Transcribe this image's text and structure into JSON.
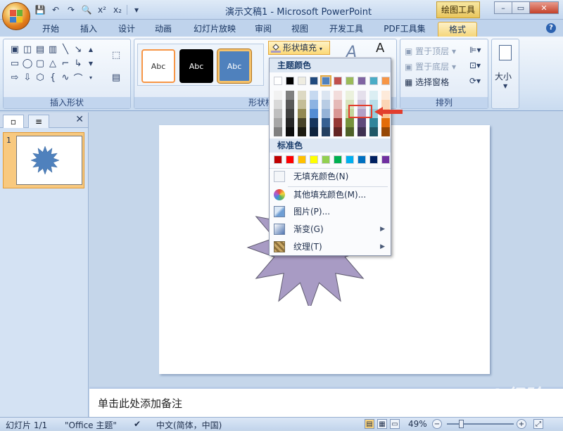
{
  "window": {
    "title": "演示文稿1 - Microsoft PowerPoint",
    "context_tab_title": "绘图工具"
  },
  "qat": {
    "save": "💾",
    "undo": "↶",
    "redo": "↷",
    "preview": "🔍",
    "superscript": "x²",
    "subscript": "x₂",
    "more": "▾"
  },
  "tabs": [
    {
      "label": "开始"
    },
    {
      "label": "插入"
    },
    {
      "label": "设计"
    },
    {
      "label": "动画"
    },
    {
      "label": "幻灯片放映"
    },
    {
      "label": "审阅"
    },
    {
      "label": "视图"
    },
    {
      "label": "开发工具"
    },
    {
      "label": "PDF工具集"
    },
    {
      "label": "格式"
    }
  ],
  "ribbon": {
    "insert_shapes_label": "插入形状",
    "shape_styles_label": "形状样式",
    "arrange_label": "排列",
    "size_label": "大小",
    "style_samples": [
      "Abc",
      "Abc",
      "Abc"
    ],
    "shape_fill_label": "形状填充",
    "arrange_items": {
      "bring_to_front": "置于顶层",
      "send_to_back": "置于底层",
      "selection_pane": "选择窗格"
    }
  },
  "dropdown": {
    "theme_colors_header": "主题颜色",
    "standard_colors_header": "标准色",
    "theme_top": [
      "#ffffff",
      "#000000",
      "#eeece1",
      "#1f497d",
      "#4f81bd",
      "#c0504d",
      "#9bbb59",
      "#8064a2",
      "#4bacc6",
      "#f79646"
    ],
    "theme_shades": [
      [
        "#f2f2f2",
        "#d9d9d9",
        "#bfbfbf",
        "#a6a6a6",
        "#808080"
      ],
      [
        "#808080",
        "#595959",
        "#404040",
        "#262626",
        "#0d0d0d"
      ],
      [
        "#ddd9c3",
        "#c4bd97",
        "#938953",
        "#494429",
        "#1d1b10"
      ],
      [
        "#c6d9f0",
        "#8db3e2",
        "#548dd4",
        "#17365d",
        "#0f243e"
      ],
      [
        "#dbe5f1",
        "#b8cce4",
        "#95b3d7",
        "#366092",
        "#244061"
      ],
      [
        "#f2dcdb",
        "#e5b9b7",
        "#d99694",
        "#953734",
        "#632423"
      ],
      [
        "#ebf1dd",
        "#d7e3bc",
        "#c3d69b",
        "#76923c",
        "#4f6128"
      ],
      [
        "#e5e0ec",
        "#ccc1d9",
        "#b2a1c7",
        "#5f497a",
        "#3f3151"
      ],
      [
        "#dbeef3",
        "#b7dde8",
        "#92cddc",
        "#31859b",
        "#205867"
      ],
      [
        "#fdeada",
        "#fbd5b5",
        "#fac08f",
        "#e36c09",
        "#974806"
      ]
    ],
    "standard": [
      "#c00000",
      "#ff0000",
      "#ffc000",
      "#ffff00",
      "#92d050",
      "#00b050",
      "#00b0f0",
      "#0070c0",
      "#002060",
      "#7030a0"
    ],
    "items": [
      {
        "label": "无填充颜色(N)"
      },
      {
        "label": "其他填充颜色(M)..."
      },
      {
        "label": "图片(P)..."
      },
      {
        "label": "渐变(G)"
      },
      {
        "label": "纹理(T)"
      }
    ]
  },
  "slide_panel": {
    "slide_number": "1"
  },
  "notes": {
    "placeholder": "单击此处添加备注"
  },
  "status": {
    "slide": "幻灯片 1/1",
    "theme": "\"Office 主题\"",
    "language": "中文(简体，中国)",
    "zoom": "49%"
  },
  "colors": {
    "star_fill": "#a89bc4",
    "star_stroke": "#5f5b6f",
    "thumb_star": "#4f81bd",
    "highlight": "#e23d2d"
  },
  "watermark": {
    "brand": "Bai 经验",
    "url": "jingyan.baidu.com"
  }
}
